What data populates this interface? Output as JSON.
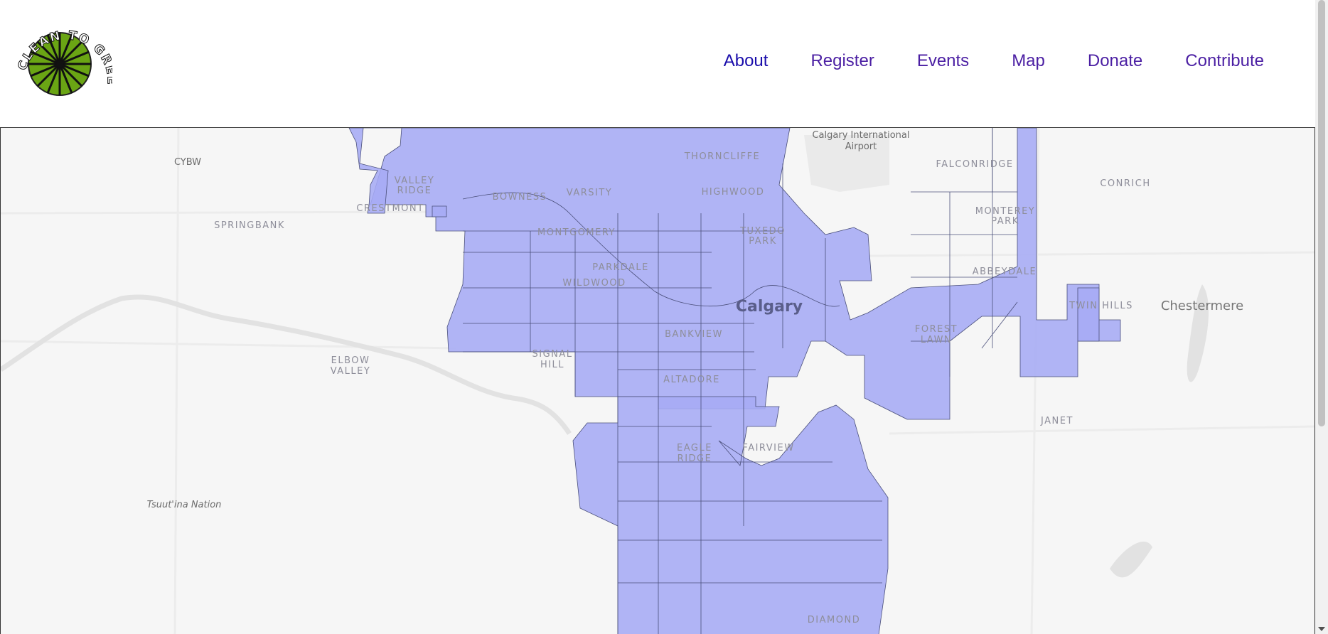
{
  "header": {
    "logo_text": "CLEAN TO GREEN",
    "nav": [
      {
        "label": "About"
      },
      {
        "label": "Register"
      },
      {
        "label": "Events"
      },
      {
        "label": "Map"
      },
      {
        "label": "Donate"
      },
      {
        "label": "Contribute"
      }
    ]
  },
  "map": {
    "city_label": "Calgary",
    "labels": {
      "airport": [
        "Calgary International",
        "Airport"
      ],
      "cybw": "CYBW",
      "springbank": "SPRINGBANK",
      "crestmont": "CRESTMONT",
      "valley_ridge": [
        "VALLEY",
        "RIDGE"
      ],
      "bowness": "BOWNESS",
      "varsity": "VARSITY",
      "thorncliffe": "THORNCLIFFE",
      "highwood": "HIGHWOOD",
      "falconridge": "FALCONRIDGE",
      "conrich": "CONRICH",
      "monterey_park": [
        "MONTEREY",
        "PARK"
      ],
      "montgomery": "MONTGOMERY",
      "tuxedo_park": [
        "TUXEDO",
        "PARK"
      ],
      "parkdale": "PARKDALE",
      "wildwood": "WILDWOOD",
      "abbeydale": "ABBEYDALE",
      "twin_hills": "TWIN HILLS",
      "chestermere": "Chestermere",
      "bankview": "BANKVIEW",
      "forest_lawn": [
        "FOREST",
        "LAWN"
      ],
      "signal_hill": [
        "SIGNAL",
        "HILL"
      ],
      "elbow_valley": [
        "ELBOW",
        "VALLEY"
      ],
      "altadore": "ALTADORE",
      "janet": "JANET",
      "eagle_ridge": [
        "EAGLE",
        "RIDGE"
      ],
      "fairview": "FAIRVIEW",
      "tsuutina": "Tsuut'ina Nation",
      "diamond": "DIAMOND"
    },
    "colors": {
      "fill": "#a6abf5",
      "stroke": "#4a4f7a",
      "background": "#f6f6f6",
      "river": "#e4e4e4"
    }
  }
}
